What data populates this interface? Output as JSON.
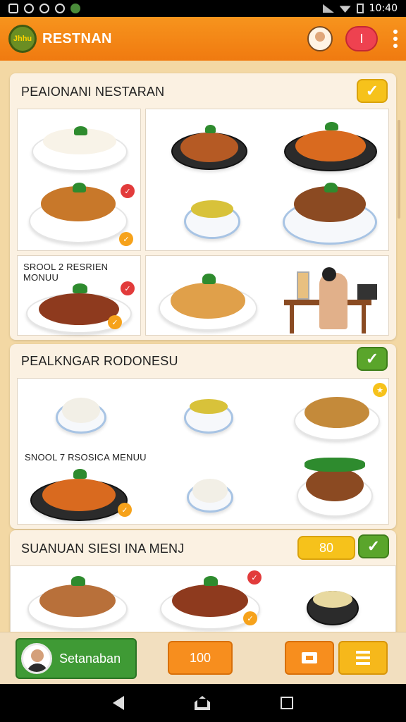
{
  "status_bar": {
    "time": "10:40",
    "left_icons": [
      "image-icon",
      "alarm-icon",
      "lock-icon",
      "shield-icon",
      "app-icon"
    ]
  },
  "app_bar": {
    "logo_text": "Jhhu",
    "title": "RESTNAN",
    "red_button_label": "I"
  },
  "sections": [
    {
      "title": "PEAIONANI NESTARAN",
      "check": "✓",
      "card_label": "SROOL 2 RESRIEN MONUU"
    },
    {
      "title": "PEALKNGAR RODONESU",
      "check": "✓",
      "card_label": "SNOOL 7 RSOSICA MENUU"
    },
    {
      "title": "SUANUAN SIESI INA MENJ",
      "badge": "80",
      "check": "✓"
    }
  ],
  "bottom_bar": {
    "primary_label": "Setanaban",
    "count_label": "100"
  },
  "colors": {
    "accent_orange": "#f7941d",
    "green": "#3f9a35",
    "yellow": "#f6c21b",
    "red": "#ee4250"
  }
}
